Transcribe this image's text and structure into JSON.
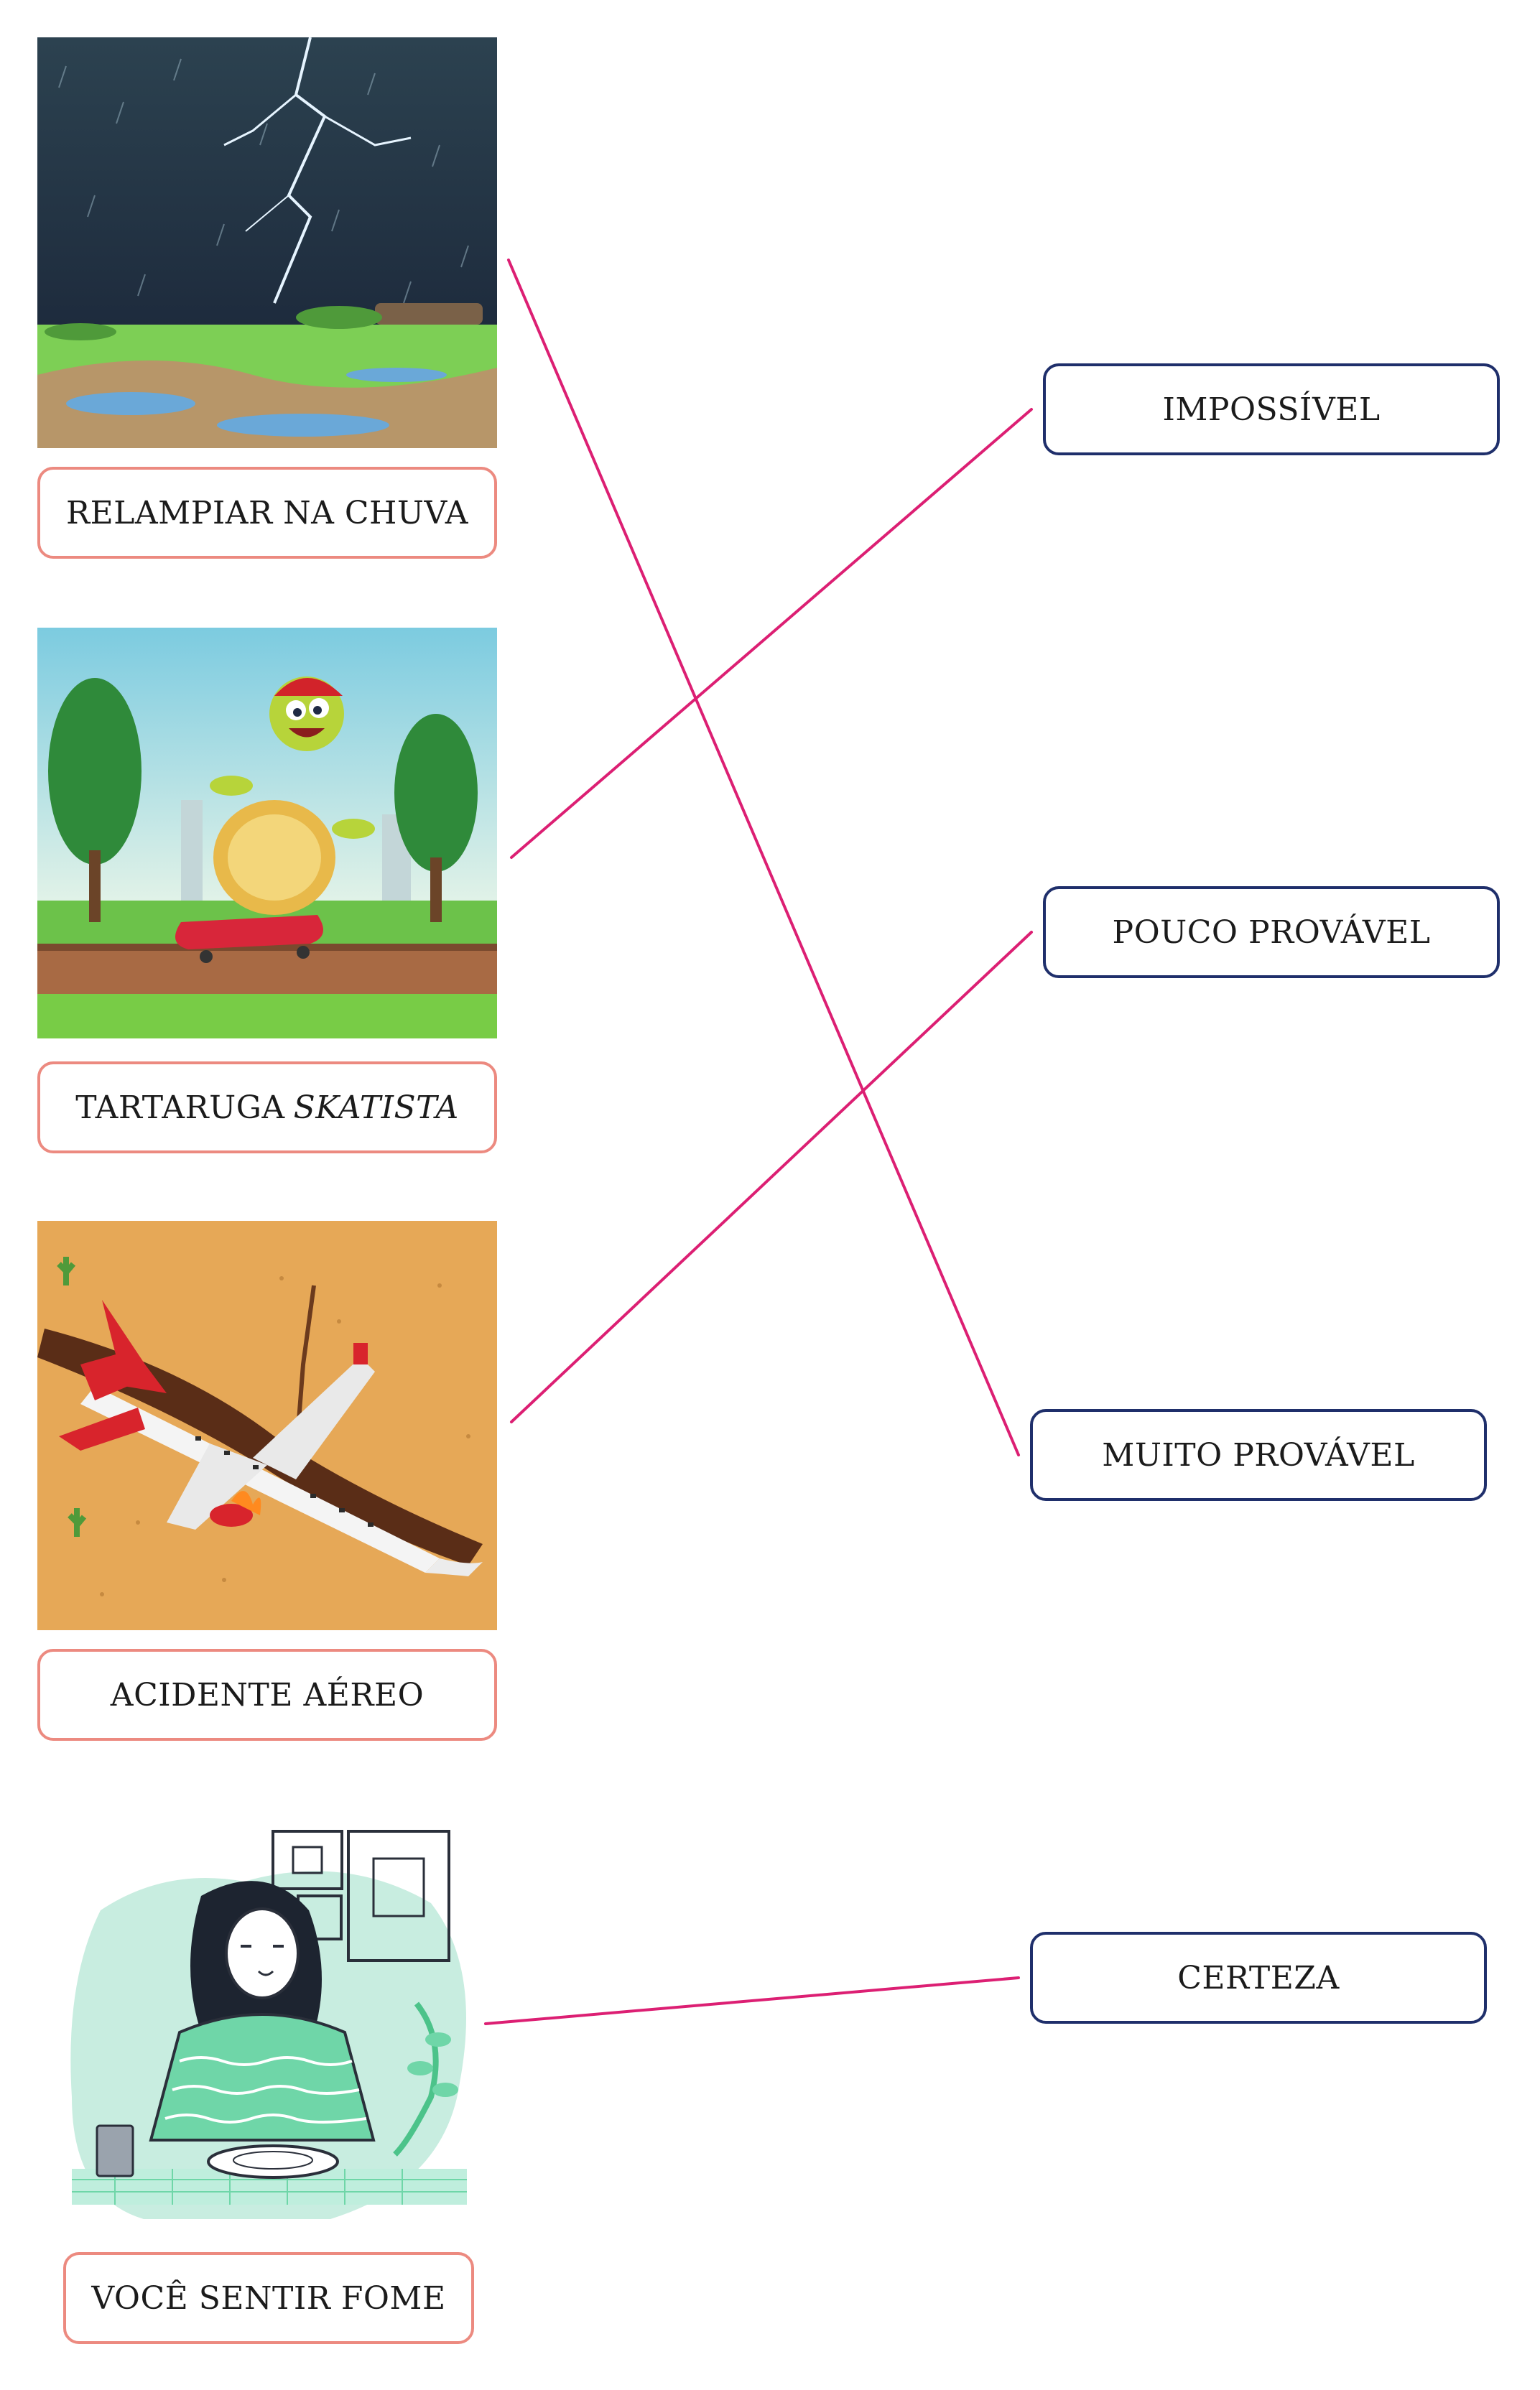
{
  "colors": {
    "connector_line": "#dc1f73",
    "left_box_border": "#ec8a80",
    "right_box_border": "#1f2f6b"
  },
  "left_items": [
    {
      "id": "relampiar",
      "label": "RELAMPIAR NA CHUVA",
      "image": "thunderstorm-image"
    },
    {
      "id": "tartaruga",
      "label": "TARTARUGA",
      "label_italic": "SKATISTA",
      "image": "skateboarding-turtle-image"
    },
    {
      "id": "acidente",
      "label": "ACIDENTE AÉREO",
      "image": "plane-crash-image"
    },
    {
      "id": "fome",
      "label": "VOCÊ SENTIR FOME",
      "image": "woman-eating-image"
    }
  ],
  "right_items": [
    {
      "id": "impossivel",
      "label": "IMPOSSÍVEL"
    },
    {
      "id": "pouco",
      "label": "POUCO PROVÁVEL"
    },
    {
      "id": "muito",
      "label": "MUITO PROVÁVEL"
    },
    {
      "id": "certeza",
      "label": "CERTEZA"
    }
  ],
  "matches": [
    {
      "from": "relampiar",
      "to": "muito"
    },
    {
      "from": "tartaruga",
      "to": "impossivel"
    },
    {
      "from": "acidente",
      "to": "pouco"
    },
    {
      "from": "fome",
      "to": "certeza"
    }
  ]
}
